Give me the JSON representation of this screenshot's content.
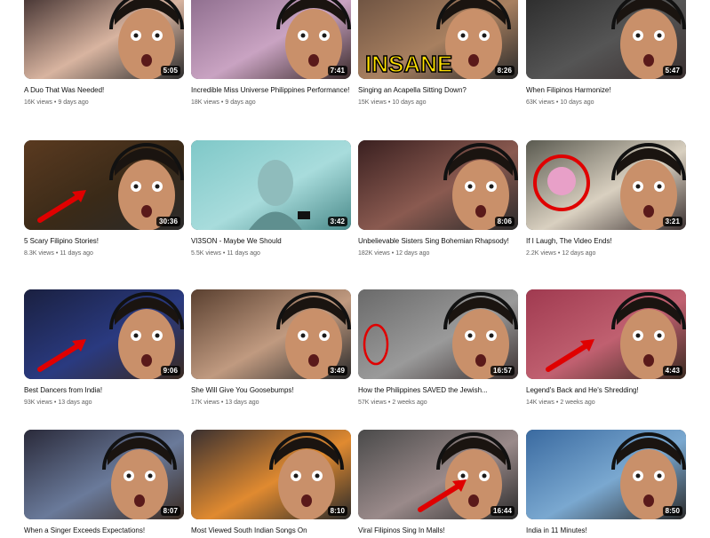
{
  "videos": [
    {
      "title": "A Duo That Was Needed!",
      "views": "16K views",
      "age": "9 days ago",
      "duration": "5:05",
      "overlay_text": ""
    },
    {
      "title": "Incredible Miss Universe Philippines Performance!",
      "views": "18K views",
      "age": "9 days ago",
      "duration": "7:41",
      "overlay_text": ""
    },
    {
      "title": "Singing an Acapella Sitting Down?",
      "views": "15K views",
      "age": "10 days ago",
      "duration": "8:26",
      "overlay_text": "INSANE"
    },
    {
      "title": "When Filipinos Harmonize!",
      "views": "63K views",
      "age": "10 days ago",
      "duration": "5:47",
      "overlay_text": ""
    },
    {
      "title": "5 Scary Filipino Stories!",
      "views": "8.3K views",
      "age": "11 days ago",
      "duration": "30:36",
      "overlay_text": ""
    },
    {
      "title": "VI3SON - Maybe We Should",
      "views": "5.5K views",
      "age": "11 days ago",
      "duration": "3:42",
      "overlay_text": ""
    },
    {
      "title": "Unbelievable Sisters Sing Bohemian Rhapsody!",
      "views": "182K views",
      "age": "12 days ago",
      "duration": "8:06",
      "overlay_text": ""
    },
    {
      "title": "If I Laugh, The Video Ends!",
      "views": "2.2K views",
      "age": "12 days ago",
      "duration": "3:21",
      "overlay_text": ""
    },
    {
      "title": "Best Dancers from India!",
      "views": "93K views",
      "age": "13 days ago",
      "duration": "9:06",
      "overlay_text": ""
    },
    {
      "title": "She Will Give You Goosebumps!",
      "views": "17K views",
      "age": "13 days ago",
      "duration": "3:49",
      "overlay_text": ""
    },
    {
      "title": "How the Philippines SAVED the Jewish...",
      "views": "57K views",
      "age": "2 weeks ago",
      "duration": "16:57",
      "overlay_text": ""
    },
    {
      "title": "Legend's Back and He's Shredding!",
      "views": "14K views",
      "age": "2 weeks ago",
      "duration": "4:43",
      "overlay_text": ""
    },
    {
      "title": "When a Singer Exceeds Expectations!",
      "views": "",
      "age": "",
      "duration": "8:07",
      "overlay_text": ""
    },
    {
      "title": "Most Viewed South Indian Songs On",
      "views": "",
      "age": "",
      "duration": "8:10",
      "overlay_text": ""
    },
    {
      "title": "Viral Filipinos Sing In Malls!",
      "views": "",
      "age": "",
      "duration": "16:44",
      "overlay_text": ""
    },
    {
      "title": "India in 11 Minutes!",
      "views": "",
      "age": "",
      "duration": "8:50",
      "overlay_text": ""
    }
  ],
  "colors": {
    "title_text": "#0f0f0f",
    "meta_text": "#606060",
    "duration_bg": "#000000",
    "highlight_red": "#e00000",
    "insane_yellow": "#ffe000"
  }
}
